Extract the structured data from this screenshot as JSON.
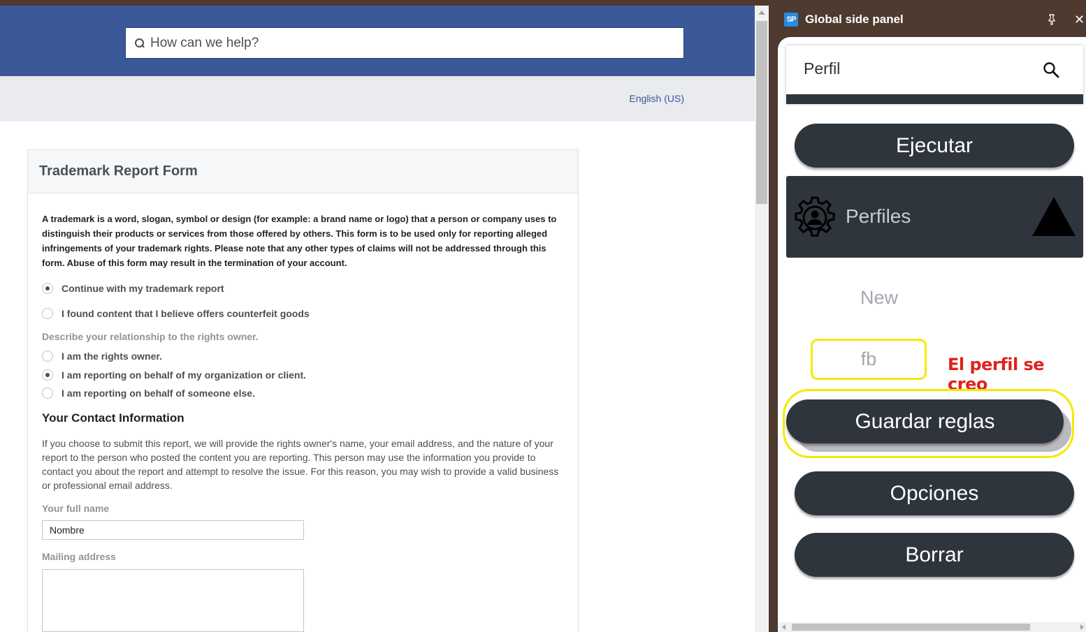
{
  "fb_page": {
    "search_placeholder": "How can we help?",
    "language": "English (US)",
    "form_title": "Trademark Report Form",
    "intro": "A trademark is a word, slogan, symbol or design (for example: a brand name or logo) that a person or company uses to distinguish their products or services from those offered by others. This form is to be used only for reporting alleged infringements of your trademark rights. Please note that any other types of claims will not be addressed through this form. Abuse of this form may result in the termination of your account.",
    "report_options": [
      {
        "label": "Continue with my trademark report",
        "selected": true
      },
      {
        "label": "I found content that I believe offers counterfeit goods",
        "selected": false
      }
    ],
    "relationship_label": "Describe your relationship to the rights owner.",
    "relationship_options": [
      {
        "label": "I am the rights owner.",
        "selected": false
      },
      {
        "label": "I am reporting on behalf of my organization or client.",
        "selected": true
      },
      {
        "label": "I am reporting on behalf of someone else.",
        "selected": false
      }
    ],
    "contact_title": "Your Contact Information",
    "contact_text": "If you choose to submit this report, we will provide the rights owner's name, your email address, and the nature of your report to the person who posted the content you are reporting. This person may use the information you provide to contact you about the report and attempt to resolve the issue. For this reason, you may wish to provide a valid business or professional email address.",
    "full_name_label": "Your full name",
    "full_name_value": "Nombre",
    "mailing_label": "Mailing address",
    "mailing_value": ""
  },
  "side_panel": {
    "logo_text": "SP",
    "title": "Global side panel",
    "search_value": "Perfil",
    "ejecutar": "Ejecutar",
    "perfiles": "Perfiles",
    "new_label": "New",
    "profile_value": "fb",
    "annotation": "El perfil se creo",
    "guardar": "Guardar reglas",
    "opciones": "Opciones",
    "borrar": "Borrar"
  },
  "colors": {
    "facebook_blue": "#3b5998",
    "panel_brown": "#4e3a2e",
    "button_dark": "#2f353d",
    "highlight_yellow": "#f5e900",
    "annotation_red": "#e0221c"
  }
}
